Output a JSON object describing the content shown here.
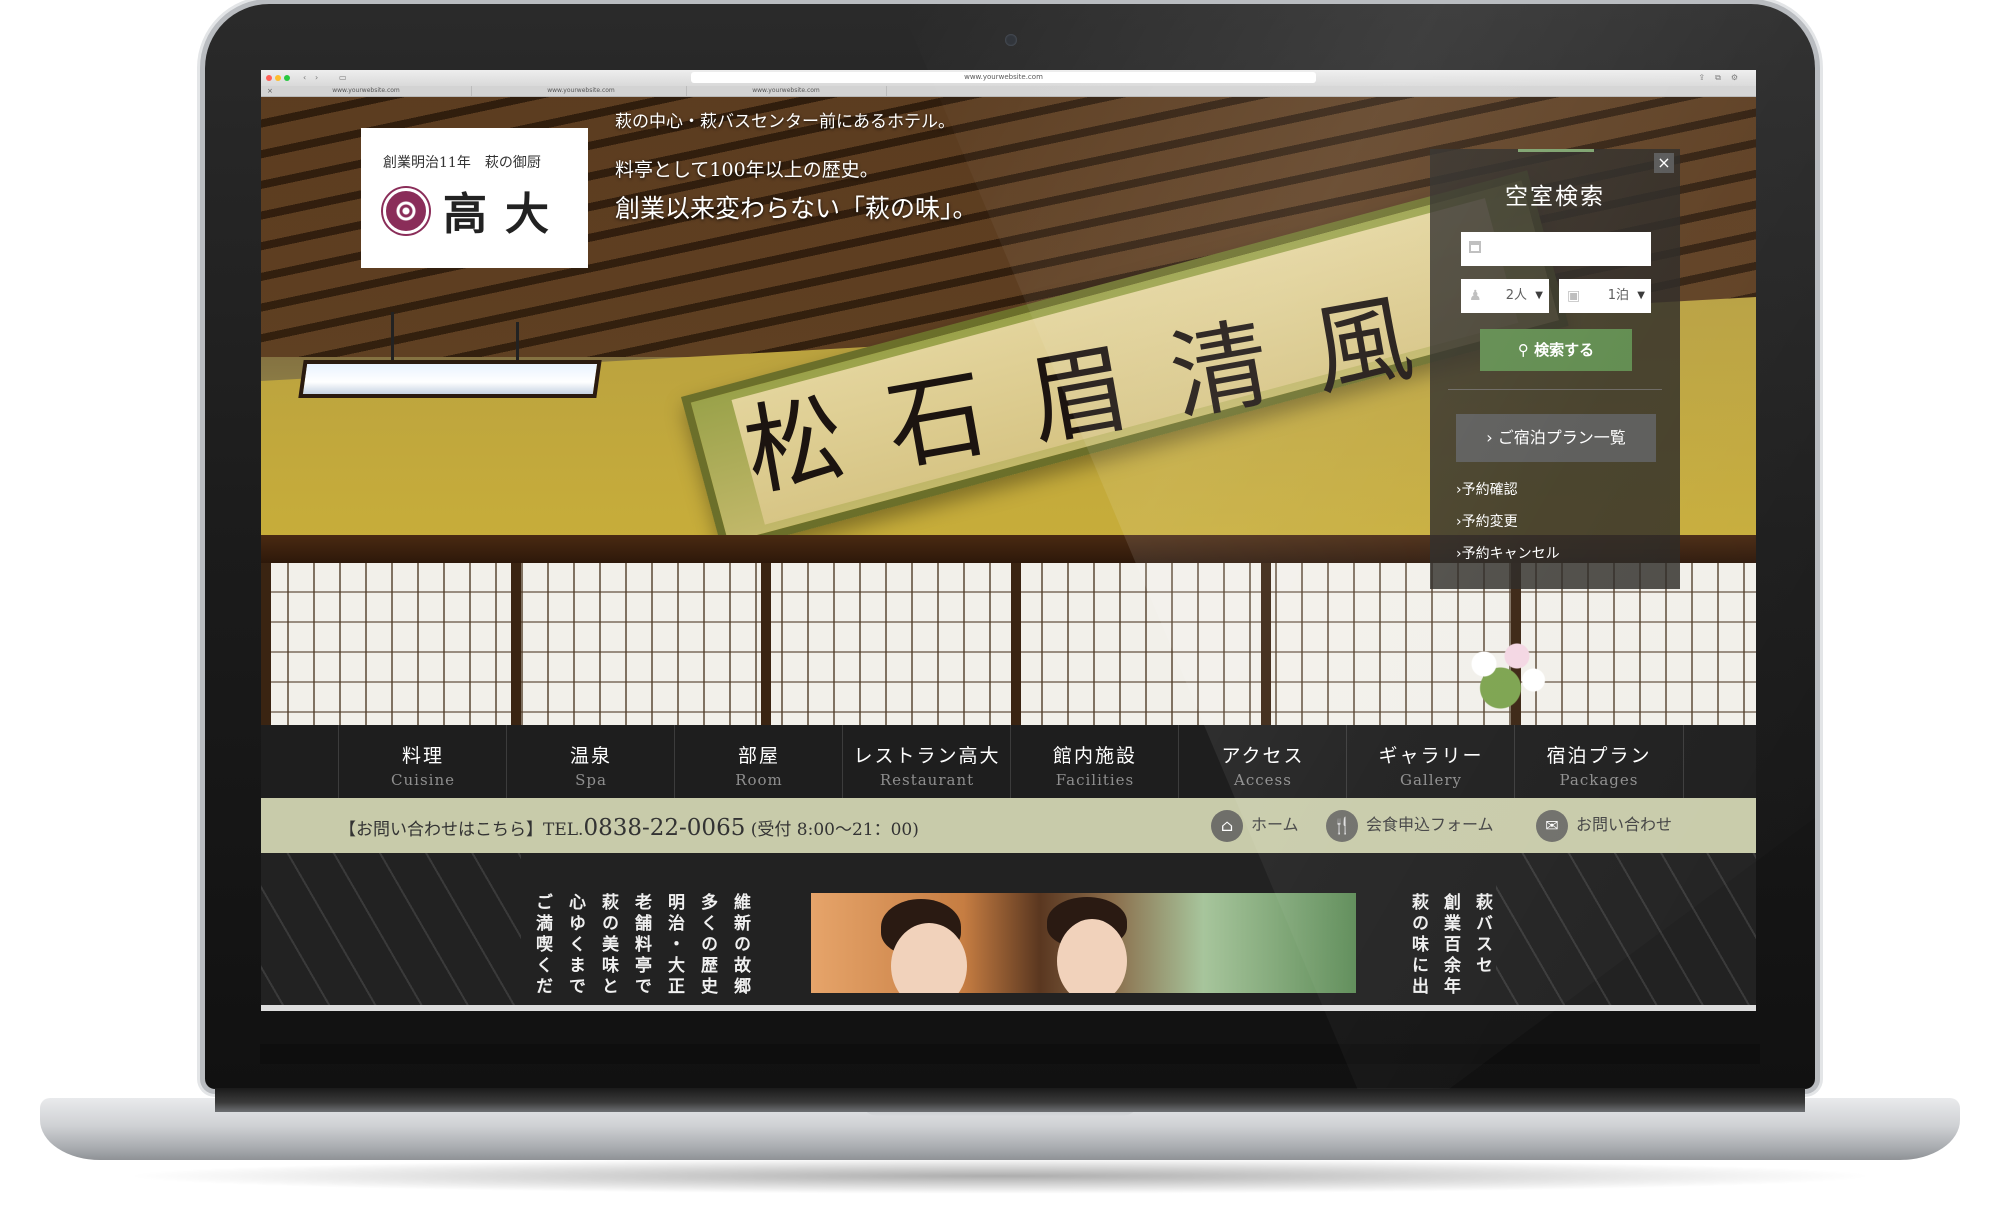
{
  "browser": {
    "address": "www.yourwebsite.com",
    "tabs": [
      "www.yourwebsite.com",
      "www.yourwebsite.com",
      "www.yourwebsite.com"
    ]
  },
  "logo": {
    "line1": "創業明治11年　萩の御厨",
    "name": "高大"
  },
  "hero": {
    "tagline1": "萩の中心・萩バスセンター前にあるホテル。",
    "tagline2": "料亭として100年以上の歴史。",
    "tagline3": "創業以来変わらない「萩の味」。",
    "calligraphy": "松石眉清風"
  },
  "search_panel": {
    "title": "空室検索",
    "close": "×",
    "date_placeholder": "",
    "guests": "2人",
    "nights": "1泊",
    "search_button": "検索する",
    "plans_button": "ご宿泊プラン一覧",
    "links": [
      "予約確認",
      "予約変更",
      "予約キャンセル"
    ]
  },
  "nav": [
    {
      "jp": "料理",
      "en": "Cuisine"
    },
    {
      "jp": "温泉",
      "en": "Spa"
    },
    {
      "jp": "部屋",
      "en": "Room"
    },
    {
      "jp": "レストラン高大",
      "en": "Restaurant"
    },
    {
      "jp": "館内施設",
      "en": "Facilities"
    },
    {
      "jp": "アクセス",
      "en": "Access"
    },
    {
      "jp": "ギャラリー",
      "en": "Gallery"
    },
    {
      "jp": "宿泊プラン",
      "en": "Packages"
    }
  ],
  "contact": {
    "label": "【お問い合わせはこちら】TEL.",
    "tel": "0838-22-0065",
    "hours": "(受付 8:00～21：00)",
    "home": "ホーム",
    "banquet": "会食申込フォーム",
    "inquiry": "お問い合わせ"
  },
  "intro_columns": [
    "維新の故郷",
    "多くの歴史",
    "明治・大正",
    "老舗料亭で",
    "萩の美味と",
    "心ゆくまで",
    "ご満喫くだ"
  ],
  "right_columns": [
    "萩バスセ",
    "創業百余年",
    "萩の味に出"
  ],
  "colors": {
    "accent_green": "#5e8a4c",
    "contact_bar": "#c8cbaa",
    "logo_crest": "#8a2d59",
    "nav_bg": "#1e1e1e"
  }
}
